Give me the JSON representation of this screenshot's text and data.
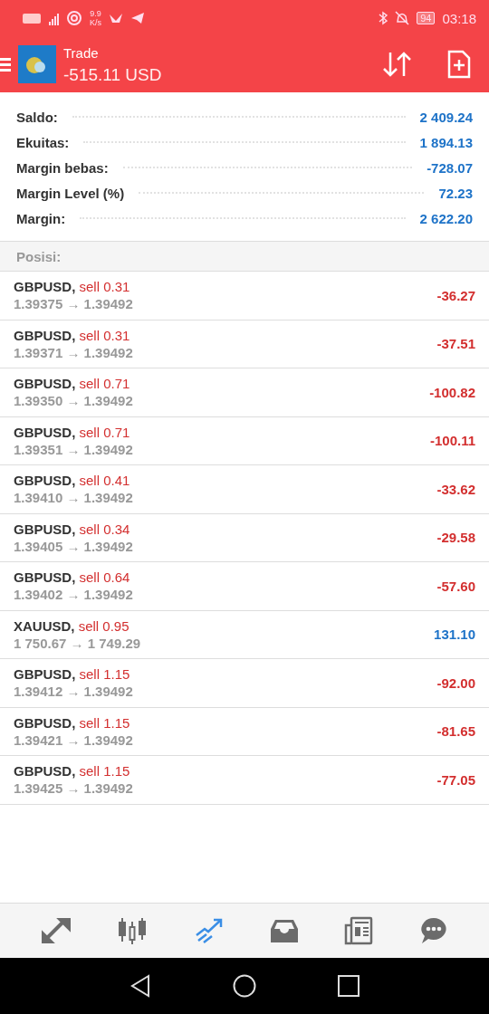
{
  "status_bar": {
    "speed_value": "9.9",
    "speed_unit": "K/s",
    "battery": "94",
    "time": "03:18"
  },
  "header": {
    "title": "Trade",
    "subtitle": "-515.11 USD"
  },
  "account": [
    {
      "label": "Saldo:",
      "value": "2 409.24"
    },
    {
      "label": "Ekuitas:",
      "value": "1 894.13"
    },
    {
      "label": "Margin bebas:",
      "value": "-728.07"
    },
    {
      "label": "Margin Level (%)",
      "value": "72.23"
    },
    {
      "label": "Margin:",
      "value": "2 622.20"
    }
  ],
  "positions": {
    "title": "Posisi:",
    "rows": [
      {
        "symbol": "GBPUSD,",
        "order": "sell 0.31",
        "prices": "1.39375 → 1.39492",
        "profit": "-36.27",
        "color": "#d32f2f"
      },
      {
        "symbol": "GBPUSD,",
        "order": "sell 0.31",
        "prices": "1.39371 → 1.39492",
        "profit": "-37.51",
        "color": "#d32f2f"
      },
      {
        "symbol": "GBPUSD,",
        "order": "sell 0.71",
        "prices": "1.39350 → 1.39492",
        "profit": "-100.82",
        "color": "#d32f2f"
      },
      {
        "symbol": "GBPUSD,",
        "order": "sell 0.71",
        "prices": "1.39351 → 1.39492",
        "profit": "-100.11",
        "color": "#d32f2f"
      },
      {
        "symbol": "GBPUSD,",
        "order": "sell 0.41",
        "prices": "1.39410 → 1.39492",
        "profit": "-33.62",
        "color": "#d32f2f"
      },
      {
        "symbol": "GBPUSD,",
        "order": "sell 0.34",
        "prices": "1.39405 → 1.39492",
        "profit": "-29.58",
        "color": "#d32f2f"
      },
      {
        "symbol": "GBPUSD,",
        "order": "sell 0.64",
        "prices": "1.39402 → 1.39492",
        "profit": "-57.60",
        "color": "#d32f2f"
      },
      {
        "symbol": "XAUUSD,",
        "order": "sell 0.95",
        "prices": "1 750.67 → 1 749.29",
        "profit": "131.10",
        "color": "#1e73c8"
      },
      {
        "symbol": "GBPUSD,",
        "order": "sell 1.15",
        "prices": "1.39412 → 1.39492",
        "profit": "-92.00",
        "color": "#d32f2f"
      },
      {
        "symbol": "GBPUSD,",
        "order": "sell 1.15",
        "prices": "1.39421 → 1.39492",
        "profit": "-81.65",
        "color": "#d32f2f"
      },
      {
        "symbol": "GBPUSD,",
        "order": "sell 1.15",
        "prices": "1.39425 → 1.39492",
        "profit": "-77.05",
        "color": "#d32f2f"
      }
    ]
  },
  "bottom_nav": [
    {
      "kind": "quotes",
      "selected": false
    },
    {
      "kind": "chart",
      "selected": false
    },
    {
      "kind": "trade",
      "selected": true
    },
    {
      "kind": "history",
      "selected": false
    },
    {
      "kind": "news",
      "selected": false
    },
    {
      "kind": "chat",
      "selected": false
    }
  ]
}
